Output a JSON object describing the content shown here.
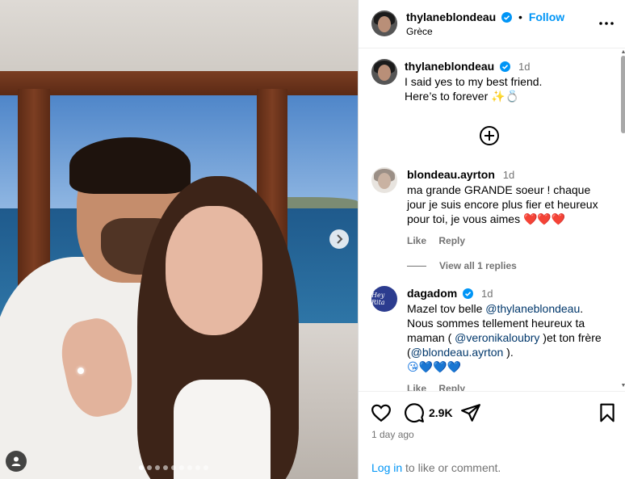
{
  "post": {
    "username": "thylaneblondeau",
    "follow_label": "Follow",
    "separator": "•",
    "location": "Grèce",
    "caption": {
      "username": "thylaneblondeau",
      "time": "1d",
      "line1": "I said yes to my best friend.",
      "line2": "Here’s to forever ✨💍"
    },
    "photo_count": 9,
    "active_photo": 1
  },
  "comments": [
    {
      "username": "blondeau.ayrton",
      "time": "1d",
      "text": "ma grande GRANDE soeur ! chaque jour je suis encore plus fier et heureux pour toi, je vous aimes",
      "emoji": "❤️❤️❤️",
      "like_label": "Like",
      "reply_label": "Reply",
      "view_replies": "View all 1 replies"
    },
    {
      "username": "dagadom",
      "time": "1d",
      "text_1": "Mazel tov belle ",
      "mention_1": "@thylaneblondeau",
      "text_2": ". Nous sommes tellement heureux ta maman ( ",
      "mention_2": "@veronikaloubry",
      "text_3": " )et ton frère (",
      "mention_3": "@blondeau.ayrton",
      "text_4": " ).",
      "emoji": "😘💙💙💙",
      "avatar_text": "Hey Rita",
      "like_label": "Like",
      "reply_label": "Reply"
    }
  ],
  "actions": {
    "comment_count": "2.9K",
    "time_ago": "1 day ago",
    "login_link": "Log in",
    "login_rest": " to like or comment."
  },
  "icons": {
    "more": "more-horizontal-icon",
    "like": "heart-outline-icon",
    "comment": "comment-bubble-icon",
    "share": "paper-plane-icon",
    "save": "bookmark-icon",
    "add": "plus-circle-icon",
    "next": "chevron-right-icon",
    "tags": "user-tag-icon",
    "verified": "verified-badge-icon"
  },
  "colors": {
    "accent": "#0095f6",
    "verified": "#0095f6",
    "muted": "#737373",
    "mention": "#00376b"
  }
}
